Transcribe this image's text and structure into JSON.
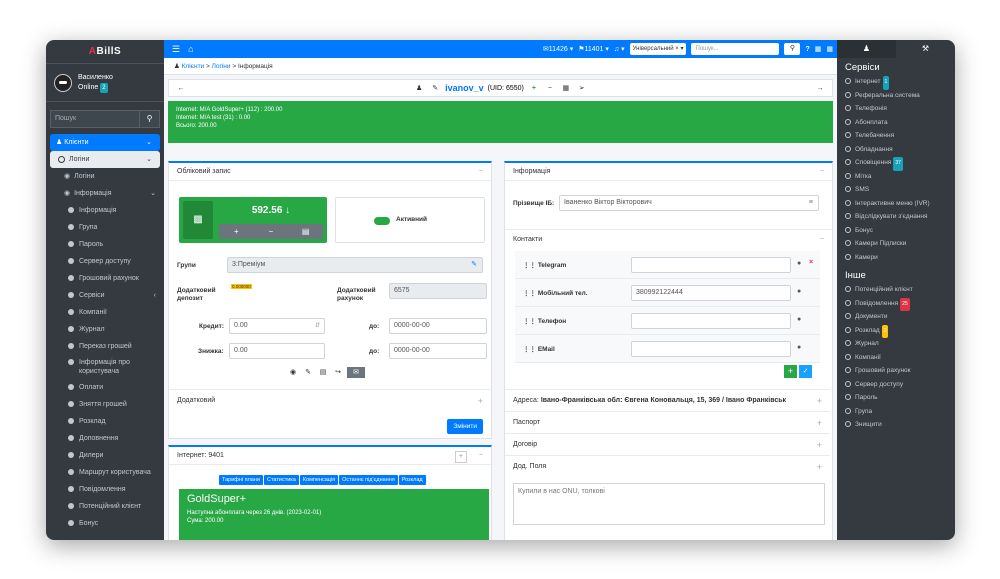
{
  "app": {
    "logo_prefix": "A",
    "logo_rest": "BillS"
  },
  "user": {
    "name": "Василенко",
    "status": "Online",
    "badge": "2"
  },
  "sidebar": {
    "search_placeholder": "Пошук",
    "items": [
      {
        "label": "Клієнти",
        "kind": "active"
      },
      {
        "label": "Логіни",
        "kind": "open"
      },
      {
        "label": "Логіни",
        "kind": "sub"
      },
      {
        "label": "Інформація",
        "kind": "sub-open"
      },
      {
        "label": "Інформація",
        "kind": "leaf"
      },
      {
        "label": "Група",
        "kind": "leaf"
      },
      {
        "label": "Пароль",
        "kind": "leaf"
      },
      {
        "label": "Сервер доступу",
        "kind": "leaf"
      },
      {
        "label": "Грошовий рахунок",
        "kind": "leaf"
      },
      {
        "label": "Сервіси",
        "kind": "leaf"
      },
      {
        "label": "Компанії",
        "kind": "leaf"
      },
      {
        "label": "Журнал",
        "kind": "leaf"
      },
      {
        "label": "Переказ грошей",
        "kind": "leaf"
      },
      {
        "label": "Інформація про користувача",
        "kind": "leaf2"
      },
      {
        "label": "Оплати",
        "kind": "leaf"
      },
      {
        "label": "Зняття грошей",
        "kind": "leaf"
      },
      {
        "label": "Розклад",
        "kind": "leaf"
      },
      {
        "label": "Доповнення",
        "kind": "leaf"
      },
      {
        "label": "Дилери",
        "kind": "leaf"
      },
      {
        "label": "Маршрут користувача",
        "kind": "leaf"
      },
      {
        "label": "Повідомлення",
        "kind": "leaf"
      },
      {
        "label": "Потенційний клієнт",
        "kind": "leaf"
      },
      {
        "label": "Бонус",
        "kind": "leaf"
      }
    ]
  },
  "topbar": {
    "mail_count": "11426",
    "msg_count": "11401",
    "selector": "Універсальний ×",
    "search_placeholder": "Пошук..."
  },
  "breadcrumb": {
    "a": "Клієнти",
    "b": "Логіни",
    "c": "Інформація"
  },
  "header": {
    "login": "ivanov_v",
    "uid": "(UID: 6550)"
  },
  "green_box": {
    "line1": "Internet: M/A GoldSuper+ (112) : 200.00",
    "line2": "Internet: M/A test (31) : 0.00",
    "line3": "Всього: 200.00"
  },
  "account": {
    "title": "Обліковий запис",
    "balance": "592.56",
    "status": "Активний",
    "groups_label": "Групи",
    "groups_value": "3:Преміум",
    "deposit_label": "Додатковий депозит",
    "deposit_badge": "0.000000",
    "extra_account_label": "Додатковий рахунок",
    "extra_account_value": "6575",
    "credit_label": "Кредит:",
    "credit_value": "0.00",
    "credit_to_label": "до:",
    "credit_to_value": "0000-00-00",
    "discount_label": "Знижка:",
    "discount_value": "0.00",
    "discount_to_label": "до:",
    "discount_to_value": "0000-00-00",
    "extra_title": "Додатковий",
    "change_button": "Змінити"
  },
  "internet": {
    "title": "Інтернет: 9401",
    "tabs": [
      "Тарифні плани",
      "Статистика",
      "Компенсація",
      "Останнє під'єднання",
      "Розклад"
    ],
    "plan": "GoldSuper+",
    "next_fee": "Наступна абонплата через 26 днів. (2023-02-01)",
    "sum": "Сума: 200.00"
  },
  "info": {
    "title": "Інформація",
    "fio_label": "Прізвище ІБ:",
    "fio_value": "Іваненко Віктор Вікторович",
    "contacts_title": "Контакти",
    "contacts": [
      {
        "label": "Telegram",
        "value": ""
      },
      {
        "label": "Мобільний тел.",
        "value": "380992122444"
      },
      {
        "label": "Телефон",
        "value": ""
      },
      {
        "label": "EMail",
        "value": ""
      }
    ],
    "address": "Адреса: ",
    "address_value": "Івано-Франківська обл: Євгена Коновальця, 15, 369 / Івано Франківськ",
    "passport": "Паспорт",
    "contract": "Договір",
    "extra_fields": "Дод. Поля",
    "comment": "Купили в нас ONU, толкові"
  },
  "right_sidebar": {
    "services_title": "Сервіси",
    "services": [
      {
        "label": "Інтернет",
        "badge": "1",
        "badge_color": "#17a2b8"
      },
      {
        "label": "Реферальна система"
      },
      {
        "label": "Телефонія"
      },
      {
        "label": "Абонплата"
      },
      {
        "label": "Телебачення"
      },
      {
        "label": "Обладнання"
      },
      {
        "label": "Сповіщення",
        "badge": "37",
        "badge_color": "#17a2b8"
      },
      {
        "label": "Мітка"
      },
      {
        "label": "SMS"
      },
      {
        "label": "Інтерактивне меню (IVR)"
      },
      {
        "label": "Відслідкувати з'єднання"
      },
      {
        "label": "Бонус"
      },
      {
        "label": "Камери Підписки"
      },
      {
        "label": "Камери"
      }
    ],
    "other_title": "Інше",
    "other": [
      {
        "label": "Потенційний клієнт"
      },
      {
        "label": "Повідомлення",
        "badge": "25",
        "badge_color": "#dc3545"
      },
      {
        "label": "Документи"
      },
      {
        "label": "Розклад",
        "badge": "2",
        "badge_color": "#ffc107"
      },
      {
        "label": "Журнал"
      },
      {
        "label": "Компанії"
      },
      {
        "label": "Грошовий рахунок"
      },
      {
        "label": "Сервер доступу"
      },
      {
        "label": "Пароль"
      },
      {
        "label": "Група"
      },
      {
        "label": "Знищити"
      }
    ]
  }
}
